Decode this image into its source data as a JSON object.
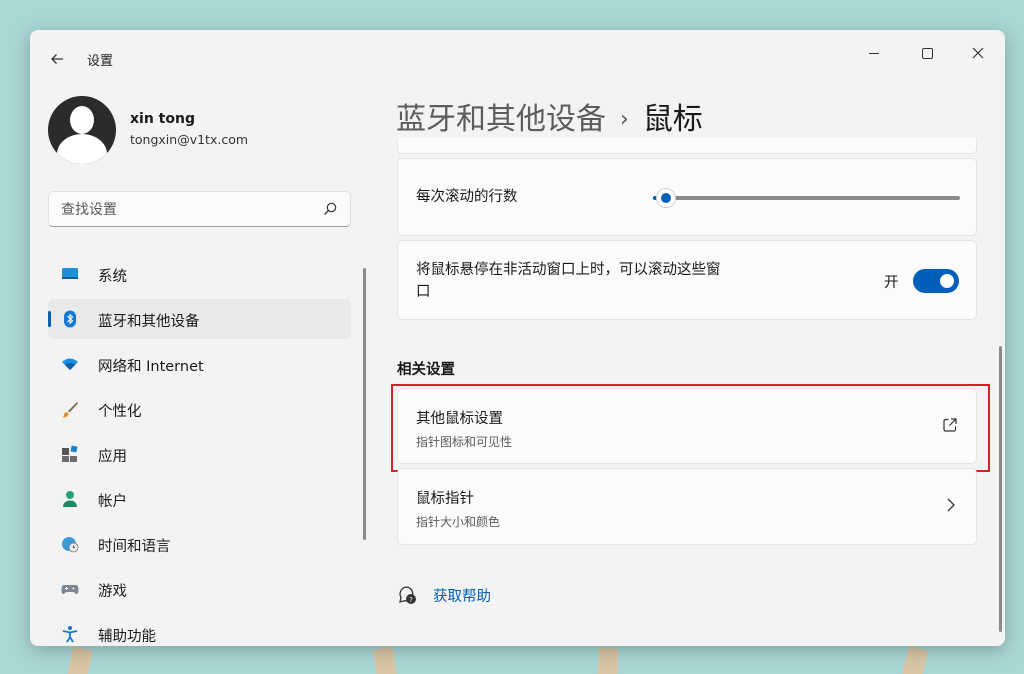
{
  "window": {
    "title": "设置"
  },
  "user": {
    "name": "xin tong",
    "email": "tongxin@v1tx.com"
  },
  "search": {
    "placeholder": "查找设置"
  },
  "sidebar": {
    "items": [
      {
        "label": "系统",
        "icon": "system-icon"
      },
      {
        "label": "蓝牙和其他设备",
        "icon": "bluetooth-icon",
        "active": true
      },
      {
        "label": "网络和 Internet",
        "icon": "wifi-icon"
      },
      {
        "label": "个性化",
        "icon": "brush-icon"
      },
      {
        "label": "应用",
        "icon": "apps-icon"
      },
      {
        "label": "帐户",
        "icon": "account-icon"
      },
      {
        "label": "时间和语言",
        "icon": "globe-clock-icon"
      },
      {
        "label": "游戏",
        "icon": "gamepad-icon"
      },
      {
        "label": "辅助功能",
        "icon": "accessibility-icon"
      }
    ]
  },
  "breadcrumb": {
    "parent": "蓝牙和其他设备",
    "separator": "›",
    "current": "鼠标"
  },
  "settings": {
    "scroll_lines": {
      "label": "每次滚动的行数",
      "value_fraction": 0.03
    },
    "scroll_inactive": {
      "label_line1": "将鼠标悬停在非活动窗口上时，可以滚动这些窗",
      "label_line2": "口",
      "state_label": "开",
      "on": true
    }
  },
  "related": {
    "title": "相关设置",
    "items": [
      {
        "title": "其他鼠标设置",
        "subtitle": "指针图标和可见性",
        "icon": "external-link-icon"
      },
      {
        "title": "鼠标指针",
        "subtitle": "指针大小和颜色",
        "icon": "chevron-right-icon"
      }
    ]
  },
  "help": {
    "label": "获取帮助",
    "icon": "help-icon"
  },
  "colors": {
    "accent": "#005fb8",
    "highlight_box": "#d6202a",
    "window_bg": "#f3f3f3",
    "card_bg": "#fbfbfb"
  }
}
